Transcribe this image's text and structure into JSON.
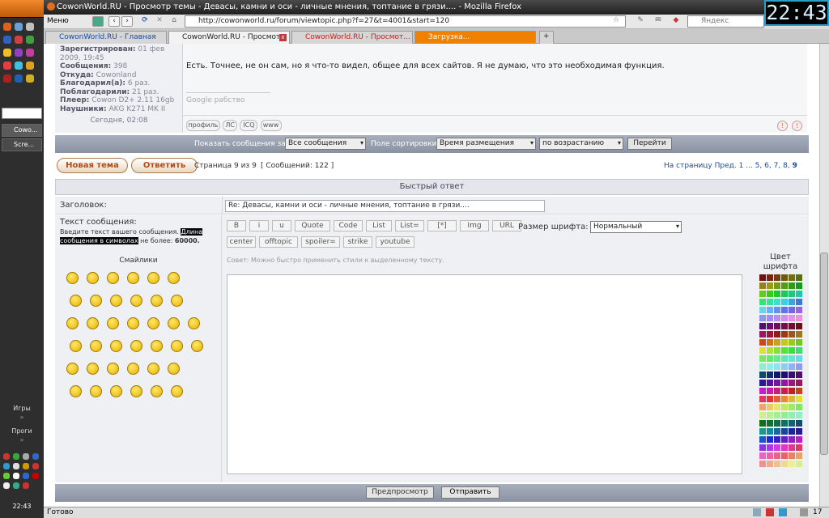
{
  "window": {
    "title": "CowonWorld.RU - Просмотр темы - Девасы, камни и оси - личные мнения, топтание в грязи.... - Mozilla Firefox",
    "clock": "22:43"
  },
  "toolbar": {
    "menu_label": "Меню",
    "url": "http://cowonworld.ru/forum/viewtopic.php?f=27&t=4001&start=120",
    "search_placeholder": "Яндекс"
  },
  "tabs": [
    {
      "label": "CowonWorld.RU - Главная"
    },
    {
      "label": "CowonWorld.RU - Просмот..."
    },
    {
      "label": "CowonWorld.RU - Просмот..."
    },
    {
      "label": "Загрузка..."
    }
  ],
  "os_sidebar": {
    "tasks": [
      {
        "label": "Cowo..."
      },
      {
        "label": "Scre..."
      }
    ],
    "sections": [
      "Игры",
      "Проги"
    ],
    "time": "22:43"
  },
  "profile": {
    "registered_label": "Зарегистрирован:",
    "registered_value": "01 фев 2009, 19:45",
    "messages_label": "Сообщения:",
    "messages_value": "398",
    "from_label": "Откуда:",
    "from_value": "Cowonland",
    "thanked_label": "Благодарил(а):",
    "thanked_value": "6 раз.",
    "got_thanks_label": "Поблагодарили:",
    "got_thanks_value": "21 раз.",
    "player_label": "Плеер:",
    "player_value": "Cowon D2+ 2.11 16gb",
    "phones_label": "Наушники:",
    "phones_value": "AKG K271 MK II",
    "post_time": "Сегодня, 02:08"
  },
  "post": {
    "text": "Есть. Точнее, не он сам, но я что-то видел, общее для всех сайтов. Я не думаю, что это необходимая функция.",
    "signature": "Google рабство",
    "actions": [
      "профиль",
      "ЛС",
      "ICQ",
      "www"
    ]
  },
  "sortbar": {
    "show_label": "Показать сообщения за:",
    "show_value": "Все сообщения",
    "sort_label": "Поле сортировки",
    "sort_value": "Время размещения",
    "order_value": "по возрастанию",
    "go_label": "Перейти"
  },
  "pagination": {
    "new_topic": "Новая тема",
    "reply": "Ответить",
    "page_info": "Страница 9 из 9",
    "messages_count": "[ Сообщений: 122 ]",
    "goto_label": "На страницу Пред.",
    "pages": [
      "1",
      "...",
      "5",
      ",",
      "6",
      ",",
      "7",
      ",",
      "8",
      ",",
      "9"
    ]
  },
  "quick_reply": {
    "header": "Быстрый ответ",
    "subject_label": "Заголовок:",
    "subject_value": "Re: Девасы, камни и оси - личные мнения, топтание в грязи....",
    "message_label": "Текст сообщения:",
    "message_hint_a": "Введите текст вашего сообщения.",
    "message_hint_b": "Длина сообщения в символах",
    "message_hint_c": "не более:",
    "message_hint_d": "60000.",
    "smilies_label": "Смайлики",
    "bbcode": [
      "B",
      "i",
      "u",
      "Quote",
      "Code",
      "List",
      "List=",
      "[*]",
      "Img",
      "URL"
    ],
    "fontsize_label": "Размер шрифта:",
    "fontsize_value": "Нормальный",
    "bbcode2": [
      "center",
      "offtopic",
      "spoiler=",
      "strike",
      "youtube"
    ],
    "tip": "Совет: Можно быстро применить стили к выделенному тексту.",
    "color_label_1": "Цвет",
    "color_label_2": "шрифта",
    "preview_button": "Предпросмотр",
    "submit_button": "Отправить"
  },
  "status": {
    "text": "Готово",
    "counter": "17"
  },
  "colors": {
    "accent": "#8a92a2",
    "link": "#1a4a9a"
  }
}
